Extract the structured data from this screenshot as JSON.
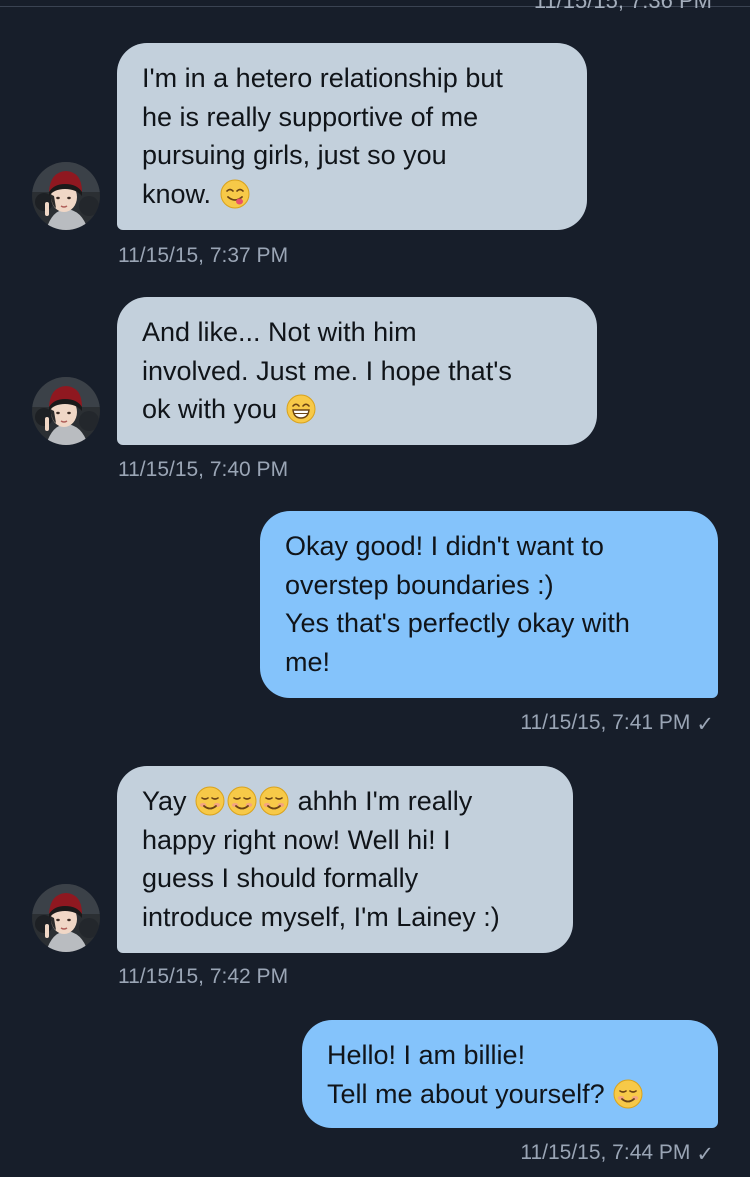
{
  "header": {
    "cut_timestamp": "11/15/15, 7:36 PM"
  },
  "messages": [
    {
      "direction": "received",
      "lines": [
        "I'm in a hetero relationship but",
        "he is really supportive of me",
        "pursuing girls, just so you",
        "know."
      ],
      "emoji": "yum-face",
      "timestamp": "11/15/15, 7:37 PM"
    },
    {
      "direction": "received",
      "lines": [
        "And like... Not with him",
        "involved. Just me. I hope that's",
        "ok with you"
      ],
      "emoji": "grinning-face",
      "timestamp": "11/15/15, 7:40 PM"
    },
    {
      "direction": "sent",
      "lines": [
        "Okay good! I didn't want to",
        "overstep boundaries :)",
        "Yes that's perfectly okay with",
        "me!"
      ],
      "timestamp": "11/15/15, 7:41 PM",
      "read_check": "✓"
    },
    {
      "direction": "received",
      "line1_prefix": "Yay",
      "line1_suffix": "ahhh I'm really",
      "lines_rest": [
        "happy right now! Well hi! I",
        "guess I should formally",
        "introduce myself, I'm Lainey :)"
      ],
      "emoji": "smiling-face",
      "emoji_count": 3,
      "timestamp": "11/15/15, 7:42 PM"
    },
    {
      "direction": "sent",
      "lines": [
        "Hello! I am billie!",
        "Tell me about yourself?"
      ],
      "emoji": "smiling-face",
      "timestamp": "11/15/15, 7:44 PM",
      "read_check": "✓"
    }
  ],
  "colors": {
    "background": "#171e2a",
    "received_bubble": "#c3d0dc",
    "sent_bubble": "#84c3fb",
    "timestamp_text": "#9aa5b5"
  }
}
